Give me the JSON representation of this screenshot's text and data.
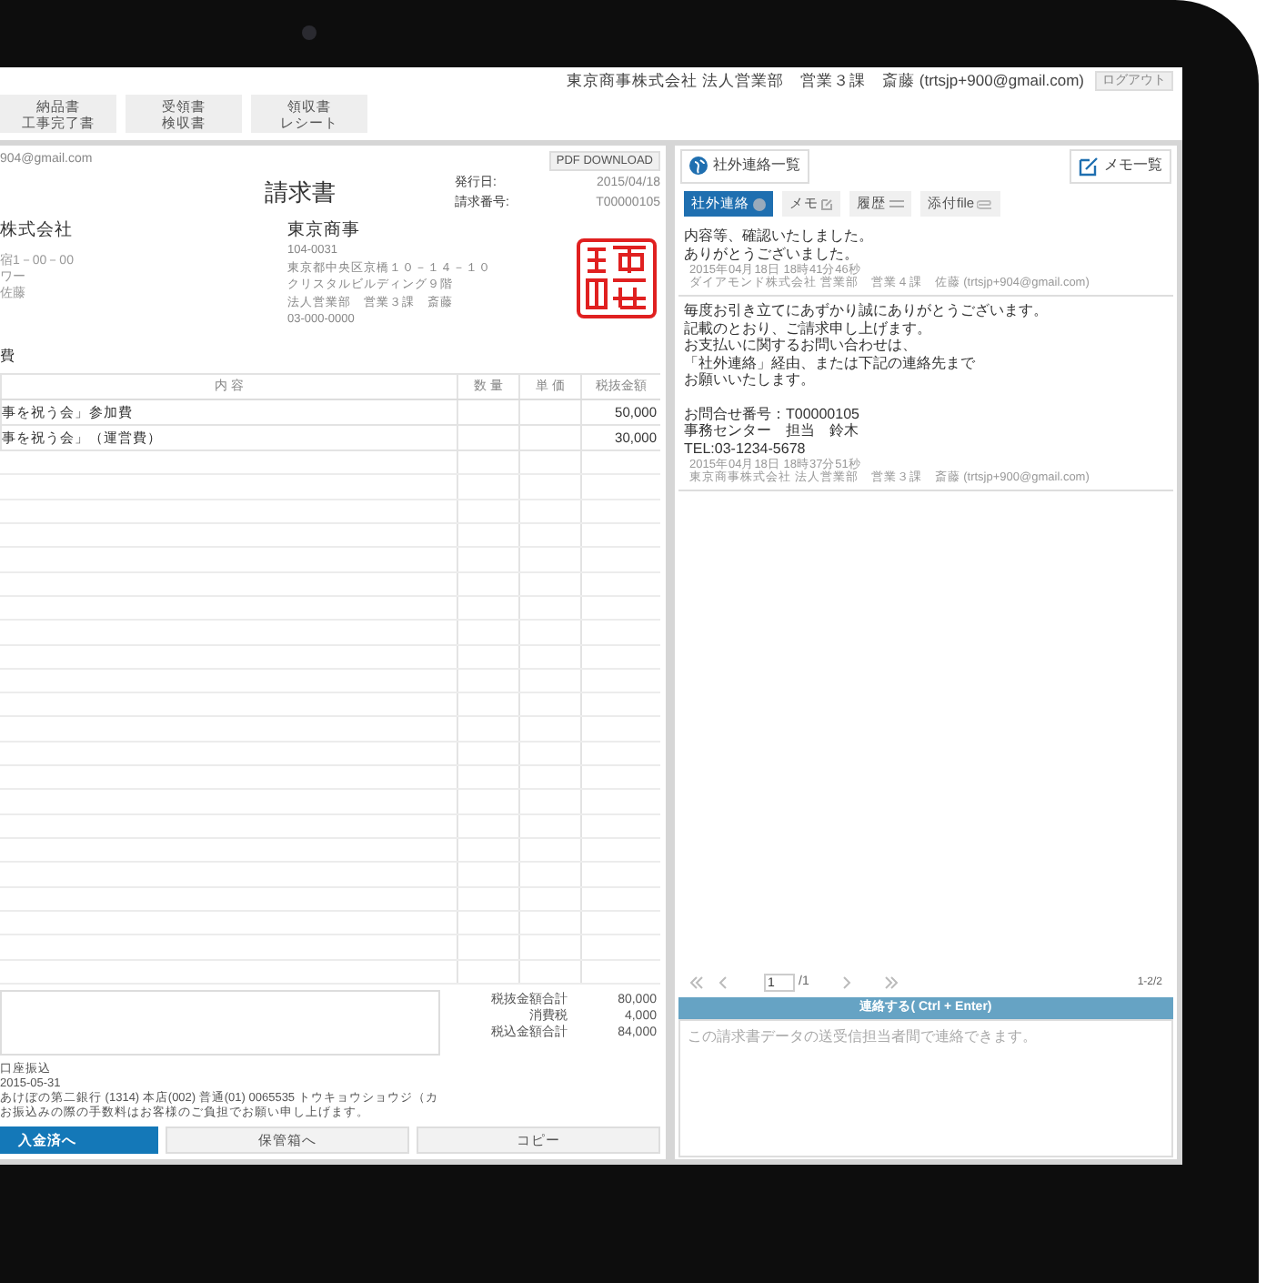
{
  "header": {
    "user": "東京商事株式会社 法人営業部　営業３課　斎藤 (trtsjp+900@gmail.com)",
    "logout": "ログアウト"
  },
  "doc_types": [
    {
      "lines": [
        "納品書",
        "工事完了書"
      ]
    },
    {
      "lines": [
        "受領書",
        "検収書"
      ]
    },
    {
      "lines": [
        "領収書",
        "レシート"
      ]
    }
  ],
  "invoice": {
    "sender_email": "904@gmail.com",
    "pdf_button": "PDF DOWNLOAD",
    "title": "請求書",
    "meta": [
      {
        "label": "発行日:",
        "value": "2015/04/18"
      },
      {
        "label": "請求番号:",
        "value": "T00000105"
      }
    ],
    "recipient": {
      "name": "株式会社",
      "lines": [
        "宿1－00－00",
        "ワー",
        "佐藤"
      ]
    },
    "issuer": {
      "name": "東京商事",
      "lines": [
        "104-0031",
        "東京都中央区京橋１０－１４－１０",
        "クリスタルビルディング９階",
        "法人営業部　営業３課　斎藤",
        "03-000-0000"
      ]
    },
    "subject": "費",
    "table": {
      "columns": [
        "内 容",
        "数 量",
        "単 価",
        "税抜金額"
      ],
      "rows": [
        [
          "事を祝う会」参加費",
          "",
          "",
          "50,000"
        ],
        [
          "事を祝う会」（運営費）",
          "",
          "",
          "30,000"
        ]
      ]
    },
    "totals": [
      {
        "label": "税抜金額合計",
        "value": "80,000"
      },
      {
        "label": "消費税",
        "value": "4,000"
      },
      {
        "label": "税込金額合計",
        "value": "84,000"
      }
    ],
    "payment": [
      "口座振込",
      "2015-05-31",
      "あけぼの第二銀行 (1314) 本店(002) 普通(01) 0065535 トウキョウショウジ（カ",
      "お振込みの際の手数料はお客様のご負担でお願い申し上げます。"
    ],
    "actions": [
      {
        "label": "入金済へ",
        "kind": "primary"
      },
      {
        "label": "保管箱へ",
        "kind": "default"
      },
      {
        "label": "コピー",
        "kind": "default"
      }
    ]
  },
  "messages_panel": {
    "list_button": "社外連絡一覧",
    "memo_button": "メモ一覧",
    "tabs": [
      {
        "label": "社外連絡",
        "selected": true
      },
      {
        "label": "メモ",
        "selected": false
      },
      {
        "label": "履歴",
        "selected": false
      },
      {
        "label": "添付file",
        "selected": false
      }
    ],
    "messages": [
      {
        "paragraphs": [
          [
            "内容等、確認いたしました。",
            "ありがとうございました。"
          ]
        ],
        "time": "2015年04月18日 18時41分46秒",
        "sender": "ダイアモンド株式会社 営業部　営業４課　佐藤 (trtsjp+904@gmail.com)"
      },
      {
        "paragraphs": [
          [
            "毎度お引き立てにあずかり誠にありがとうございます。",
            "記載のとおり、ご請求申し上げます。",
            "お支払いに関するお問い合わせは、",
            "「社外連絡」経由、または下記の連絡先まで",
            "お願いいたします。"
          ],
          [
            "お問合せ番号：T00000105",
            "事務センター　担当　鈴木",
            "TEL:03-1234-5678"
          ]
        ],
        "time": "2015年04月18日 18時37分51秒",
        "sender": "東京商事株式会社 法人営業部　営業３課　斎藤 (trtsjp+900@gmail.com)"
      }
    ],
    "pagination": {
      "page": "1",
      "total": "/1",
      "range": "1-2/2"
    },
    "send_bar": "連絡する( Ctrl + Enter)",
    "compose": {
      "placeholder": "この請求書データの送受信担当者間で連絡できます。"
    }
  }
}
